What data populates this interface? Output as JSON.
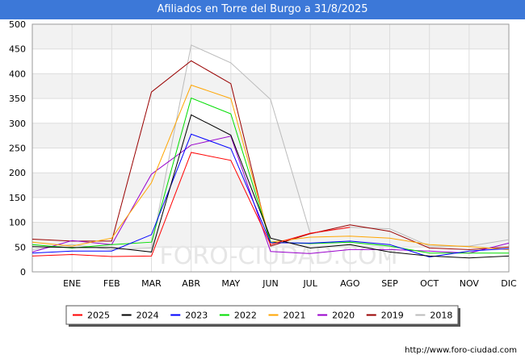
{
  "title": "Afiliados en Torre del Burgo a 31/8/2025",
  "footer": "http://www.foro-ciudad.com",
  "watermark": "FORO-CIUDAD.COM",
  "chart_data": {
    "type": "line",
    "title": "Afiliados en Torre del Burgo a 31/8/2025",
    "categories": [
      "",
      "ENE",
      "FEB",
      "MAR",
      "ABR",
      "MAY",
      "JUN",
      "JUL",
      "AGO",
      "SEP",
      "OCT",
      "NOV",
      "DIC"
    ],
    "ylim": [
      0,
      500
    ],
    "yticks": [
      0,
      50,
      100,
      150,
      200,
      250,
      300,
      350,
      400,
      450,
      500
    ],
    "grid": true,
    "legend_position": "bottom",
    "series": [
      {
        "name": "2025",
        "color": "#ff0000",
        "values": [
          32,
          35,
          31,
          32,
          241,
          225,
          55,
          78,
          90,
          null,
          null,
          null,
          null
        ]
      },
      {
        "name": "2024",
        "color": "#000000",
        "values": [
          51,
          49,
          49,
          40,
          317,
          276,
          68,
          48,
          55,
          40,
          32,
          28,
          32
        ]
      },
      {
        "name": "2023",
        "color": "#0000ff",
        "values": [
          38,
          42,
          42,
          75,
          278,
          249,
          59,
          58,
          62,
          55,
          30,
          42,
          47
        ]
      },
      {
        "name": "2022",
        "color": "#00dd00",
        "values": [
          55,
          48,
          55,
          60,
          351,
          319,
          60,
          57,
          60,
          52,
          38,
          38,
          38
        ]
      },
      {
        "name": "2021",
        "color": "#ffa500",
        "values": [
          60,
          52,
          68,
          180,
          377,
          350,
          60,
          70,
          72,
          68,
          55,
          51,
          45
        ]
      },
      {
        "name": "2020",
        "color": "#9900cc",
        "values": [
          40,
          63,
          55,
          197,
          256,
          274,
          41,
          37,
          45,
          45,
          42,
          38,
          58
        ]
      },
      {
        "name": "2019",
        "color": "#990000",
        "values": [
          66,
          62,
          62,
          363,
          426,
          380,
          52,
          77,
          95,
          82,
          48,
          45,
          50
        ]
      },
      {
        "name": "2018",
        "color": "#bbbbbb",
        "values": [
          45,
          55,
          45,
          48,
          458,
          422,
          348,
          77,
          90,
          87,
          52,
          52,
          65
        ]
      }
    ]
  }
}
